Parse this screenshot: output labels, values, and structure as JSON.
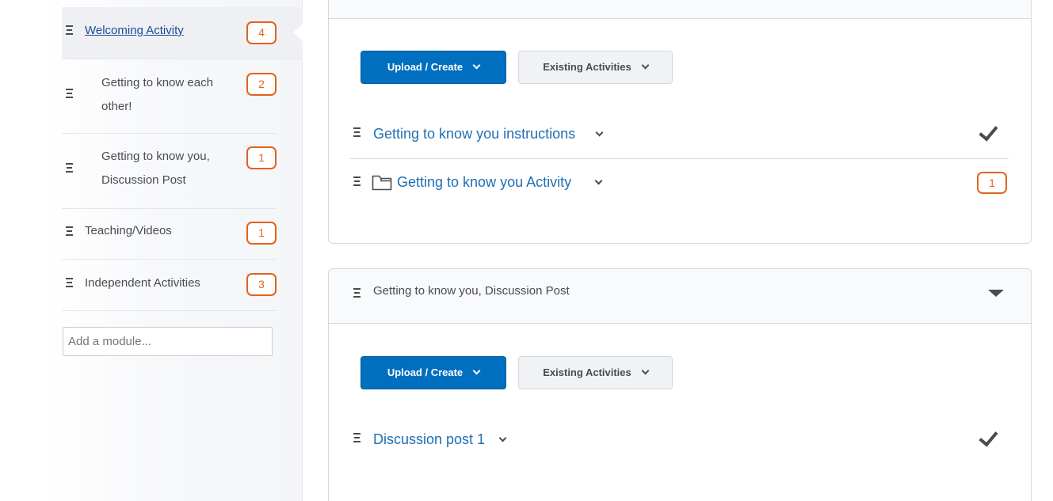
{
  "sidebar": {
    "modules": [
      {
        "label": "Welcoming Activity",
        "count": "4"
      },
      {
        "label": "Getting to know each other!",
        "count": "2"
      },
      {
        "label": "Getting to know you, Discussion Post",
        "count": "1"
      },
      {
        "label": "Teaching/Videos",
        "count": "1"
      },
      {
        "label": "Independent Activities",
        "count": "3"
      }
    ],
    "add_module_placeholder": "Add a module..."
  },
  "panel_top": {
    "upload_label": "Upload / Create",
    "existing_label": "Existing Activities",
    "topics": [
      {
        "title": "Getting to know you instructions",
        "status": "completed"
      },
      {
        "title": "Getting to know you Activity",
        "count": "1",
        "icon": "folder-icon"
      }
    ]
  },
  "panel_bottom": {
    "section_title": "Getting to know you, Discussion Post",
    "upload_label": "Upload / Create",
    "existing_label": "Existing Activities",
    "topics": [
      {
        "title": "Discussion post 1",
        "status": "completed"
      }
    ]
  },
  "colors": {
    "accent": "#006fbf",
    "link": "#1e6fb3",
    "badge": "#e2631b"
  }
}
